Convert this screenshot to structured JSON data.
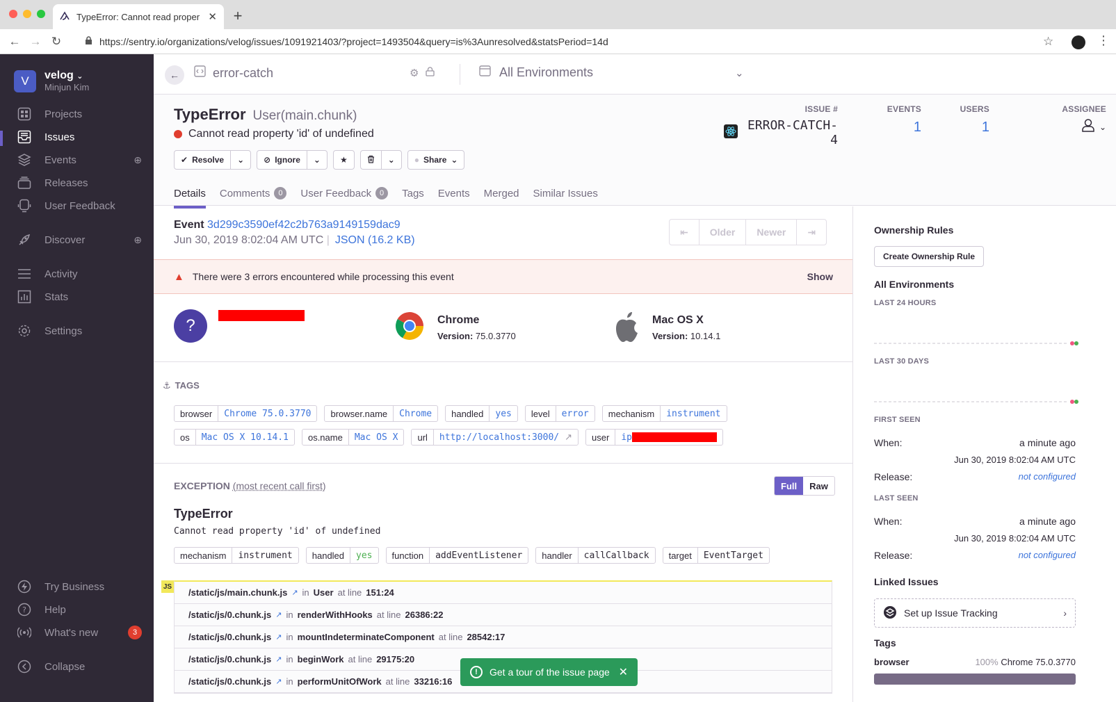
{
  "browser": {
    "tab_title": "TypeError: Cannot read proper",
    "url": "https://sentry.io/organizations/velog/issues/1091921403/?project=1493504&query=is%3Aunresolved&statsPeriod=14d"
  },
  "sidebar": {
    "org_initial": "V",
    "org_name": "velog",
    "user_name": "Minjun Kim",
    "items": [
      {
        "label": "Projects",
        "icon": "projects-icon"
      },
      {
        "label": "Issues",
        "icon": "issues-icon"
      },
      {
        "label": "Events",
        "icon": "events-icon"
      },
      {
        "label": "Releases",
        "icon": "releases-icon"
      },
      {
        "label": "User Feedback",
        "icon": "feedback-icon"
      },
      {
        "label": "Discover",
        "icon": "discover-icon"
      },
      {
        "label": "Activity",
        "icon": "activity-icon"
      },
      {
        "label": "Stats",
        "icon": "stats-icon"
      },
      {
        "label": "Settings",
        "icon": "settings-icon"
      }
    ],
    "bottom": [
      {
        "label": "Try Business",
        "icon": "lightning-icon"
      },
      {
        "label": "Help",
        "icon": "help-icon"
      },
      {
        "label": "What's new",
        "icon": "broadcast-icon",
        "badge": "3"
      },
      {
        "label": "Collapse",
        "icon": "collapse-icon"
      }
    ]
  },
  "topbar": {
    "project": "error-catch",
    "environment": "All Environments"
  },
  "issue": {
    "type": "TypeError",
    "culprit": "User(main.chunk)",
    "message": "Cannot read property 'id' of undefined",
    "level_color": "#e03e2f",
    "actions": {
      "resolve": "Resolve",
      "ignore": "Ignore",
      "share": "Share"
    },
    "stats": {
      "issue_label": "ISSUE #",
      "issue_id": "ERROR-CATCH-4",
      "events_label": "EVENTS",
      "events": "1",
      "users_label": "USERS",
      "users": "1",
      "assignee_label": "ASSIGNEE"
    },
    "tabs": [
      {
        "label": "Details"
      },
      {
        "label": "Comments",
        "count": "0"
      },
      {
        "label": "User Feedback",
        "count": "0"
      },
      {
        "label": "Tags"
      },
      {
        "label": "Events"
      },
      {
        "label": "Merged"
      },
      {
        "label": "Similar Issues"
      }
    ]
  },
  "event": {
    "label": "Event",
    "id": "3d299c3590ef42c2b763a9149159dac9",
    "date": "Jun 30, 2019 8:02:04 AM UTC",
    "json": "JSON (16.2 KB)",
    "pager": [
      "Older",
      "Newer"
    ],
    "alert": "There were 3 errors encountered while processing this event",
    "alert_action": "Show",
    "contexts": {
      "user_icon": "?",
      "browser_name": "Chrome",
      "browser_version_label": "Version:",
      "browser_version": "75.0.3770",
      "os_name": "Mac OS X",
      "os_version_label": "Version:",
      "os_version": "10.14.1"
    }
  },
  "tags": {
    "title": "TAGS",
    "row1": [
      {
        "k": "browser",
        "v": "Chrome 75.0.3770"
      },
      {
        "k": "browser.name",
        "v": "Chrome"
      },
      {
        "k": "handled",
        "v": "yes"
      },
      {
        "k": "level",
        "v": "error"
      },
      {
        "k": "mechanism",
        "v": "instrument"
      }
    ],
    "row2": [
      {
        "k": "os",
        "v": "Mac OS X 10.14.1"
      },
      {
        "k": "os.name",
        "v": "Mac OS X"
      },
      {
        "k": "url",
        "v": "http://localhost:3000/"
      },
      {
        "k": "user",
        "v": "ip"
      }
    ]
  },
  "exception": {
    "title": "EXCEPTION",
    "subtitle": "(most recent call first)",
    "full": "Full",
    "raw": "Raw",
    "type": "TypeError",
    "value": "Cannot read property 'id' of undefined",
    "mechanism": [
      {
        "k": "mechanism",
        "v": "instrument"
      },
      {
        "k": "handled",
        "v": "yes"
      },
      {
        "k": "function",
        "v": "addEventListener"
      },
      {
        "k": "handler",
        "v": "callCallback"
      },
      {
        "k": "target",
        "v": "EventTarget"
      }
    ],
    "platform": "JS",
    "frames": [
      {
        "file": "/static/js/main.chunk.js",
        "fn": "User",
        "line": "151:24"
      },
      {
        "file": "/static/js/0.chunk.js",
        "fn": "renderWithHooks",
        "line": "26386:22"
      },
      {
        "file": "/static/js/0.chunk.js",
        "fn": "mountIndeterminateComponent",
        "line": "28542:17"
      },
      {
        "file": "/static/js/0.chunk.js",
        "fn": "beginWork",
        "line": "29175:20"
      },
      {
        "file": "/static/js/0.chunk.js",
        "fn": "performUnitOfWork",
        "line": "33216:16"
      }
    ],
    "in": "in",
    "at_line": "at line"
  },
  "toast": "Get a tour of the issue page",
  "aside": {
    "ownership": "Ownership Rules",
    "create_rule": "Create Ownership Rule",
    "env": "All Environments",
    "last24": "LAST 24 HOURS",
    "last30": "LAST 30 DAYS",
    "first_seen": "FIRST SEEN",
    "last_seen": "LAST SEEN",
    "when": "When:",
    "ago": "a minute ago",
    "date": "Jun 30, 2019 8:02:04 AM UTC",
    "release": "Release:",
    "not_configured": "not configured",
    "linked": "Linked Issues",
    "setup": "Set up Issue Tracking",
    "tags": "Tags",
    "tag_name": "browser",
    "tag_pct": "100%",
    "tag_val": "Chrome 75.0.3770"
  }
}
